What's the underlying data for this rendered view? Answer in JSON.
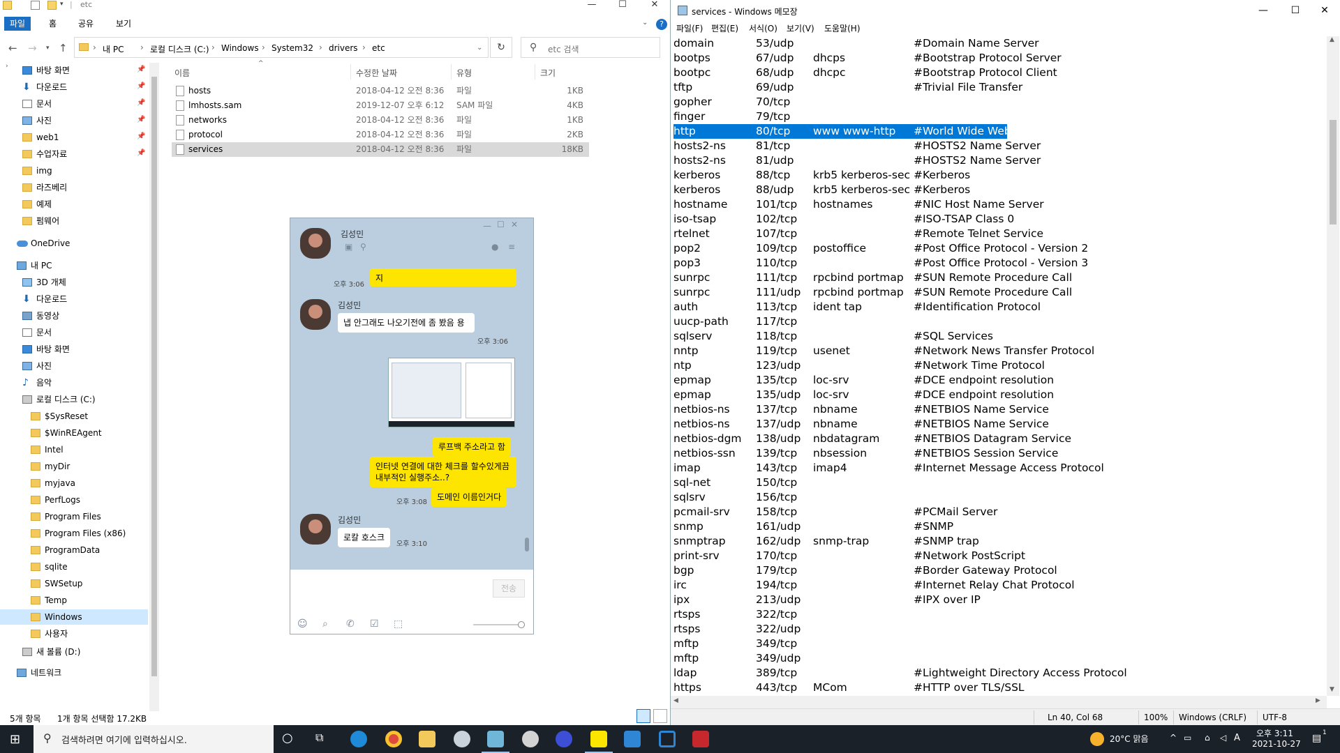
{
  "explorer": {
    "title": "etc",
    "ribbon_tabs": [
      "파일",
      "홈",
      "공유",
      "보기"
    ],
    "breadcrumb": [
      "내 PC",
      "로컬 디스크 (C:)",
      "Windows",
      "System32",
      "drivers",
      "etc"
    ],
    "search_placeholder": "etc 검색",
    "columns": [
      "이름",
      "수정한 날짜",
      "유형",
      "크기"
    ],
    "files": [
      {
        "name": "hosts",
        "date": "2018-04-12 오전 8:36",
        "type": "파일",
        "size": "1KB"
      },
      {
        "name": "lmhosts.sam",
        "date": "2019-12-07 오후 6:12",
        "type": "SAM 파일",
        "size": "4KB"
      },
      {
        "name": "networks",
        "date": "2018-04-12 오전 8:36",
        "type": "파일",
        "size": "1KB"
      },
      {
        "name": "protocol",
        "date": "2018-04-12 오전 8:36",
        "type": "파일",
        "size": "2KB"
      },
      {
        "name": "services",
        "date": "2018-04-12 오전 8:36",
        "type": "파일",
        "size": "18KB"
      }
    ],
    "nav": {
      "quick": [
        "바탕 화면",
        "다운로드",
        "문서",
        "사진",
        "web1",
        "수업자료",
        "img",
        "라즈베리",
        "예제",
        "펌웨어"
      ],
      "onedrive": "OneDrive",
      "pc": "내 PC",
      "pc_items": [
        "3D 개체",
        "다운로드",
        "동영상",
        "문서",
        "바탕 화면",
        "사진",
        "음악",
        "로컬 디스크 (C:)"
      ],
      "c_items": [
        "$SysReset",
        "$WinREAgent",
        "Intel",
        "myDir",
        "myjava",
        "PerfLogs",
        "Program Files",
        "Program Files (x86)",
        "ProgramData",
        "sqlite",
        "SWSetup",
        "Temp",
        "Windows",
        "사용자"
      ],
      "d_drive": "새 볼륨 (D:)",
      "network": "네트워크"
    },
    "status_count": "5개 항목",
    "status_selected": "1개 항목 선택함 17.2KB"
  },
  "notepad": {
    "title": "services - Windows 메모장",
    "menu": [
      "파일(F)",
      "편집(E)",
      "서식(O)",
      "보기(V)",
      "도움말(H)"
    ],
    "lines": [
      [
        "domain",
        "53/udp",
        "",
        "#Domain Name Server"
      ],
      [
        "bootps",
        "67/udp",
        "dhcps",
        "#Bootstrap Protocol Server"
      ],
      [
        "bootpc",
        "68/udp",
        "dhcpc",
        "#Bootstrap Protocol Client"
      ],
      [
        "tftp",
        "69/udp",
        "",
        "#Trivial File Transfer"
      ],
      [
        "gopher",
        "70/tcp",
        "",
        ""
      ],
      [
        "finger",
        "79/tcp",
        "",
        ""
      ],
      [
        "http",
        "80/tcp",
        "www www-http",
        "#World Wide Web"
      ],
      [
        "hosts2-ns",
        "81/tcp",
        "",
        "#HOSTS2 Name Server"
      ],
      [
        "hosts2-ns",
        "81/udp",
        "",
        "#HOSTS2 Name Server"
      ],
      [
        "kerberos",
        "88/tcp",
        "krb5 kerberos-sec",
        "#Kerberos"
      ],
      [
        "kerberos",
        "88/udp",
        "krb5 kerberos-sec",
        "#Kerberos"
      ],
      [
        "hostname",
        "101/tcp",
        "hostnames",
        "#NIC Host Name Server"
      ],
      [
        "iso-tsap",
        "102/tcp",
        "",
        "#ISO-TSAP Class 0"
      ],
      [
        "rtelnet",
        "107/tcp",
        "",
        "#Remote Telnet Service"
      ],
      [
        "pop2",
        "109/tcp",
        "postoffice",
        "#Post Office Protocol - Version 2"
      ],
      [
        "pop3",
        "110/tcp",
        "",
        "#Post Office Protocol - Version 3"
      ],
      [
        "sunrpc",
        "111/tcp",
        "rpcbind portmap",
        "#SUN Remote Procedure Call"
      ],
      [
        "sunrpc",
        "111/udp",
        "rpcbind portmap",
        "#SUN Remote Procedure Call"
      ],
      [
        "auth",
        "113/tcp",
        "ident tap",
        "#Identification Protocol"
      ],
      [
        "uucp-path",
        "117/tcp",
        "",
        ""
      ],
      [
        "sqlserv",
        "118/tcp",
        "",
        "#SQL Services"
      ],
      [
        "nntp",
        "119/tcp",
        "usenet",
        "#Network News Transfer Protocol"
      ],
      [
        "ntp",
        "123/udp",
        "",
        "#Network Time Protocol"
      ],
      [
        "epmap",
        "135/tcp",
        "loc-srv",
        "#DCE endpoint resolution"
      ],
      [
        "epmap",
        "135/udp",
        "loc-srv",
        "#DCE endpoint resolution"
      ],
      [
        "netbios-ns",
        "137/tcp",
        "nbname",
        "#NETBIOS Name Service"
      ],
      [
        "netbios-ns",
        "137/udp",
        "nbname",
        "#NETBIOS Name Service"
      ],
      [
        "netbios-dgm",
        "138/udp",
        "nbdatagram",
        "#NETBIOS Datagram Service"
      ],
      [
        "netbios-ssn",
        "139/tcp",
        "nbsession",
        "#NETBIOS Session Service"
      ],
      [
        "imap",
        "143/tcp",
        "imap4",
        "#Internet Message Access Protocol"
      ],
      [
        "sql-net",
        "150/tcp",
        "",
        ""
      ],
      [
        "sqlsrv",
        "156/tcp",
        "",
        ""
      ],
      [
        "pcmail-srv",
        "158/tcp",
        "",
        "#PCMail Server"
      ],
      [
        "snmp",
        "161/udp",
        "",
        "#SNMP"
      ],
      [
        "snmptrap",
        "162/udp",
        "snmp-trap",
        "#SNMP trap"
      ],
      [
        "print-srv",
        "170/tcp",
        "",
        "#Network PostScript"
      ],
      [
        "bgp",
        "179/tcp",
        "",
        "#Border Gateway Protocol"
      ],
      [
        "irc",
        "194/tcp",
        "",
        "#Internet Relay Chat Protocol"
      ],
      [
        "ipx",
        "213/udp",
        "",
        "#IPX over IP"
      ],
      [
        "rtsps",
        "322/tcp",
        "",
        ""
      ],
      [
        "rtsps",
        "322/udp",
        "",
        ""
      ],
      [
        "mftp",
        "349/tcp",
        "",
        ""
      ],
      [
        "mftp",
        "349/udp",
        "",
        ""
      ],
      [
        "ldap",
        "389/tcp",
        "",
        "#Lightweight Directory Access Protocol"
      ],
      [
        "https",
        "443/tcp",
        "MCom",
        "#HTTP over TLS/SSL"
      ]
    ],
    "selected_line": 6,
    "status_pos": "Ln 40, Col 68",
    "status_zoom": "100%",
    "status_eol": "Windows (CRLF)",
    "status_enc": "UTF-8"
  },
  "kakao": {
    "name": "김성민",
    "msgs": {
      "m1": "지",
      "t1": "오후 3:06",
      "sender2": "김성민",
      "m2": "냅 안그래도 나오기전에 좀 봤음 용",
      "t2": "오후 3:06",
      "m3": "루프백 주소라고 함",
      "m4": "인터넷 연결에 대한 체크를 할수있게끔 내부적인 실행주소..?",
      "m5": "도메인 이름인거다",
      "t5": "오후 3:08",
      "sender6": "김성민",
      "m6": "로칼 호스크",
      "t6": "오후 3:10"
    },
    "send": "전송"
  },
  "taskbar": {
    "search_placeholder": "검색하려면 여기에 입력하십시오.",
    "weather": "20°C 맑음",
    "ime": "A",
    "time": "오후 3:11",
    "date": "2021-10-27",
    "notif_count": "1"
  }
}
